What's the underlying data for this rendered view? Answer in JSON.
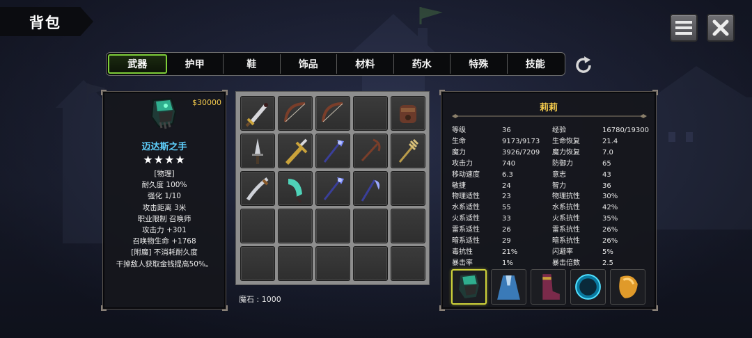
{
  "title": "背包",
  "icons": {
    "menu": "menu-icon",
    "close": "close-icon",
    "refresh": "refresh-icon"
  },
  "tabs": [
    {
      "label": "武器",
      "active": true
    },
    {
      "label": "护甲",
      "active": false
    },
    {
      "label": "鞋",
      "active": false
    },
    {
      "label": "饰品",
      "active": false
    },
    {
      "label": "材料",
      "active": false
    },
    {
      "label": "药水",
      "active": false
    },
    {
      "label": "特殊",
      "active": false
    },
    {
      "label": "技能",
      "active": false
    }
  ],
  "item_detail": {
    "icon": "gauntlet-icon",
    "price": "$30000",
    "name": "迈达斯之手",
    "stars": "★★★★",
    "lines": [
      "[物理]",
      "耐久度 100%",
      "强化 1/10",
      "攻击距离  3米",
      "职业限制  召唤师",
      "攻击力  +301",
      "召唤物生命  +1768",
      "[附魔] 不消耗耐久度",
      "干掉敌人获取金钱提高50%。"
    ]
  },
  "inventory": {
    "slots": [
      "sword-icon",
      "bow-icon",
      "bow-icon",
      "",
      "fist-weapon-icon",
      "dagger-icon",
      "greatsword-icon",
      "staff-icon",
      "crossbow-icon",
      "trident-icon",
      "scimitar-icon",
      "claw-blade-icon",
      "staff-icon",
      "scythe-icon",
      "",
      "",
      "",
      "",
      "",
      "",
      "",
      "",
      "",
      "",
      ""
    ],
    "magic_stone": "魔石 : 1000"
  },
  "character": {
    "name": "莉莉",
    "stats": [
      [
        "等级",
        "36",
        "经验",
        "16780/19300"
      ],
      [
        "生命",
        "9173/9173",
        "生命恢复",
        "21.4"
      ],
      [
        "魔力",
        "3926/7209",
        "魔力恢复",
        "7.0"
      ],
      [
        "攻击力",
        "740",
        "防御力",
        "65"
      ],
      [
        "移动速度",
        "6.3",
        "意志",
        "43"
      ],
      [
        "敏捷",
        "24",
        "智力",
        "36"
      ],
      [
        "物理适性",
        "23",
        "物理抗性",
        "30%"
      ],
      [
        "水系适性",
        "55",
        "水系抗性",
        "42%"
      ],
      [
        "火系适性",
        "33",
        "火系抗性",
        "35%"
      ],
      [
        "雷系适性",
        "26",
        "雷系抗性",
        "26%"
      ],
      [
        "暗系适性",
        "29",
        "暗系抗性",
        "26%"
      ],
      [
        "毒抗性",
        "21%",
        "闪避率",
        "5%"
      ],
      [
        "暴击率",
        "1%",
        "暴击倍数",
        "2.5"
      ]
    ],
    "equipment": [
      {
        "icon": "gauntlet-icon",
        "selected": true
      },
      {
        "icon": "robe-icon",
        "selected": false
      },
      {
        "icon": "boots-icon",
        "selected": false
      },
      {
        "icon": "orb-icon",
        "selected": false
      },
      {
        "icon": "amber-gem-icon",
        "selected": false
      }
    ]
  },
  "colors": {
    "accent_tab": "#7fcf3a",
    "item_name": "#5fd2ff",
    "gold": "#f2c94c"
  }
}
